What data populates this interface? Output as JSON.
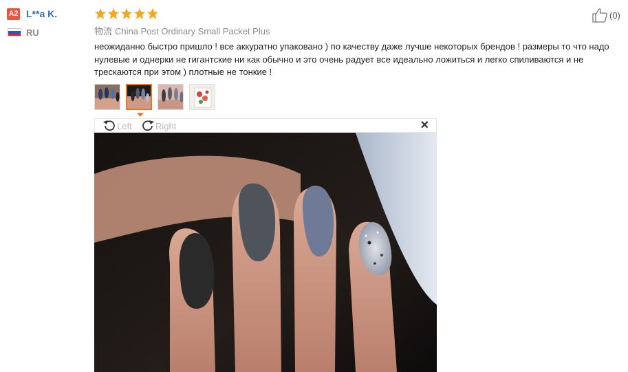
{
  "reviewer": {
    "badge": "A2",
    "name": "L**a K.",
    "country": "RU"
  },
  "rating": {
    "stars": 5,
    "max": 5,
    "star_color": "#f5a623"
  },
  "shipping": {
    "label": "物流",
    "method": "China Post Ordinary Small Packet Plus"
  },
  "review_text": "неожиданно быстро пришло ! все аккуратно упаковано ) по качеству даже лучше некоторых брендов ! размеры то что надо нулевые и однерки не гигантские ни как обычно и это очень радует все идеально ложиться и легко спиливаются и не трескаются при этом ) плотные не тонкие !",
  "helpful": {
    "count_label": "(0)",
    "icon": "thumbs-up-icon"
  },
  "thumbnails": [
    {
      "name": "thumbnail-1",
      "active": false
    },
    {
      "name": "thumbnail-2",
      "active": true
    },
    {
      "name": "thumbnail-3",
      "active": false
    },
    {
      "name": "thumbnail-4",
      "active": false
    }
  ],
  "viewer": {
    "rotate_left_label": "Left",
    "rotate_right_label": "Right",
    "close_icon": "close-icon"
  },
  "colors": {
    "accent": "#f5731f",
    "username": "#2f6fb7",
    "badge": "#e8553c"
  }
}
